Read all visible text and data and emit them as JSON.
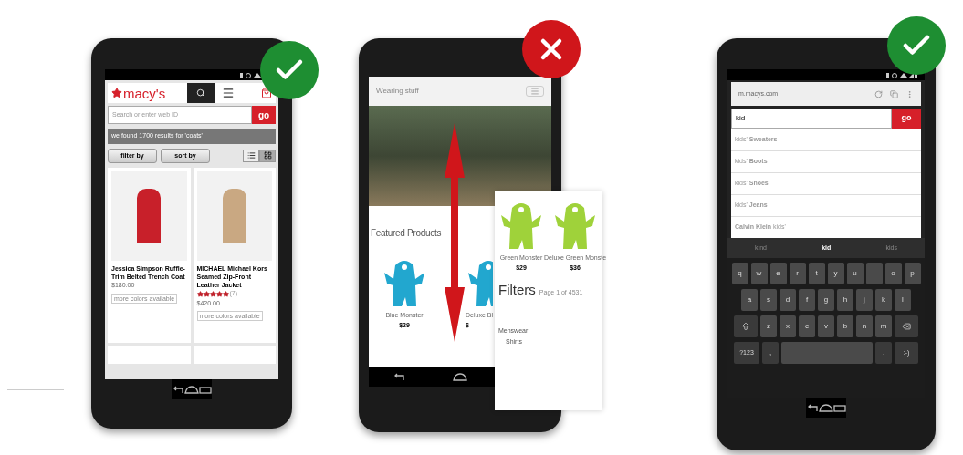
{
  "phones": [
    {
      "kind": "good",
      "logo": "macy's",
      "search": {
        "placeholder": "Search or enter web ID",
        "button": "go"
      },
      "results": "we found 1700 results for 'coats'",
      "buttons": [
        "filter by",
        "sort by"
      ],
      "views": [
        {
          "kind": "list",
          "selected": false
        },
        {
          "kind": "grid",
          "selected": true
        }
      ],
      "products": [
        {
          "name": "Jessica Simpson Ruffle-Trim Belted Trench Coat",
          "price": "$180.00",
          "note": "more colors available",
          "color": "#c8202a"
        },
        {
          "name": "MICHAEL Michael Kors Seamed Zip-Front Leather Jacket",
          "stars": 5,
          "count": "(7)",
          "price": "$420.00",
          "note": "more colors available",
          "color": "#c9a882"
        }
      ]
    },
    {
      "kind": "bad",
      "title": "Wearing stuff",
      "heading": "Featured Products",
      "products": [
        {
          "name": "Blue Monster",
          "price": "$29"
        },
        {
          "name": "Deluxe Bl",
          "price": "$"
        }
      ],
      "overlay": {
        "products": [
          {
            "name": "Green Monster",
            "price": "$29"
          },
          {
            "name": "Deluxe Green Monste",
            "price": "$36"
          }
        ],
        "filters": "Filters",
        "page": "Page 1 of 4531",
        "category": "Menswear",
        "subcategory": "Shirts"
      }
    },
    {
      "kind": "good",
      "url": "m.macys.com",
      "search": {
        "value": "kid",
        "button": "go"
      },
      "suggestions": [
        "kids' **Sweaters**",
        "kids' **Boots**",
        "kids' **Shoes**",
        "kids' **Jeans**",
        "**Calvin Klein** kids'"
      ],
      "words": [
        {
          "text": "kind",
          "selected": false
        },
        {
          "text": "kid",
          "selected": true
        },
        {
          "text": "kids",
          "selected": false
        }
      ],
      "keys": [
        [
          "q",
          "w",
          "e",
          "r",
          "t",
          "y",
          "u",
          "i",
          "o",
          "p"
        ],
        [
          "a",
          "s",
          "d",
          "f",
          "g",
          "h",
          "j",
          "k",
          "l"
        ],
        [
          "z",
          "x",
          "c",
          "v",
          "b",
          "n",
          "m"
        ]
      ],
      "bottom_keys": [
        "?123",
        ",",
        ".",
        ":-)"
      ]
    }
  ]
}
